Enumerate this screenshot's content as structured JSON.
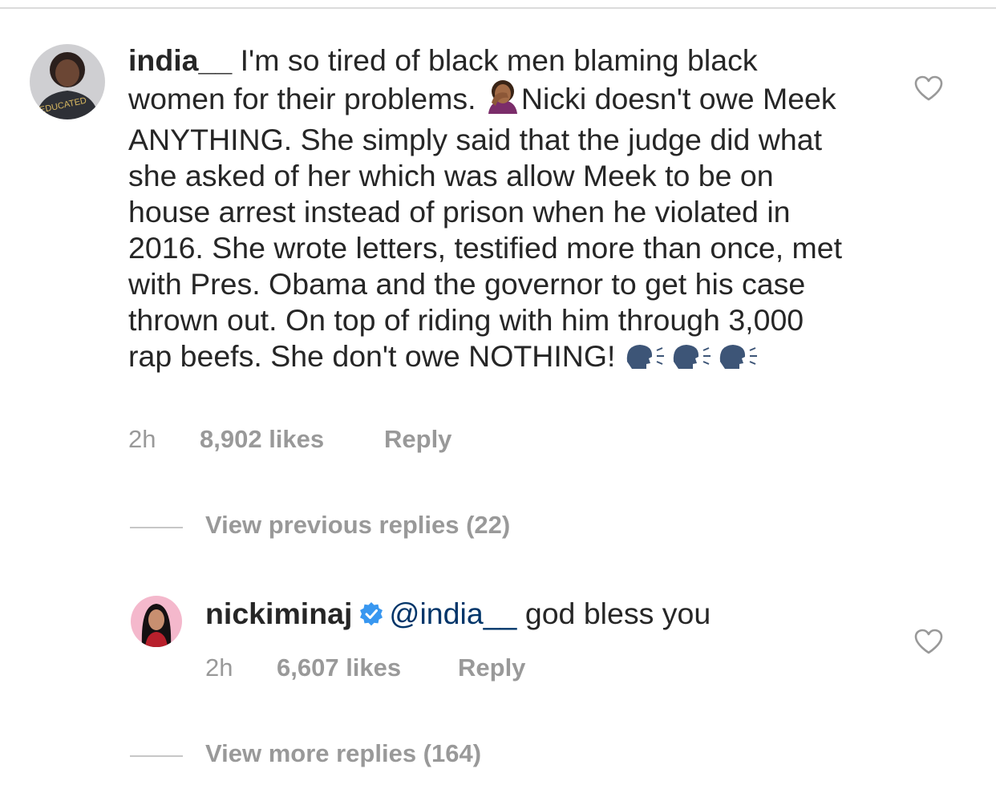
{
  "comment": {
    "username": "india__",
    "text_before_emoji": "I'm so tired of black men blaming black women for their problems. ",
    "emoji_1": "face-palm-woman-emoji",
    "text_after_emoji": "Nicki doesn't owe Meek ANYTHING. She simply said that the judge did what she asked of her which was allow Meek to be on house arrest instead of prison when he violated in 2016. She wrote letters, testified more than once, met with Pres. Obama and the governor to get his case thrown out. On top of riding with him through 3,000 rap beefs. She don't owe NOTHING! ",
    "emoji_2": "speaking-head-emoji",
    "avatar_text": "EDUCATED",
    "time": "2h",
    "likes": "8,902 likes",
    "reply_label": "Reply"
  },
  "view_previous_replies": "View previous replies (22)",
  "reply": {
    "username": "nickiminaj",
    "verified": true,
    "mention": "@india__",
    "text": " god bless you",
    "time": "2h",
    "likes": "6,607 likes",
    "reply_label": "Reply"
  },
  "view_more_replies": "View more replies (164)",
  "colors": {
    "text": "#262626",
    "meta": "#999999",
    "mention": "#003569",
    "verified": "#3897f0",
    "divider": "#dbdbdb"
  }
}
